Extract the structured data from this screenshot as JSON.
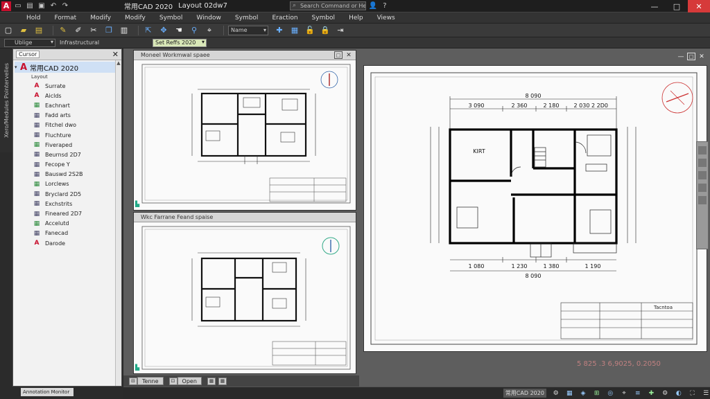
{
  "window": {
    "title": "常用CAD 2020",
    "document": "Layout 02dw7",
    "search_placeholder": "Search Command or Help",
    "min_label": "—",
    "max_label": "□",
    "close_label": "✕"
  },
  "menu": [
    "Hold",
    "Format",
    "Modify",
    "Modify",
    "Symbol",
    "Window",
    "Symbol",
    "Eraction",
    "Symbol",
    "Help",
    "Views"
  ],
  "toolbar": {
    "combo1": "Name",
    "combo2": "Name"
  },
  "layerbar": {
    "layer_combo": "Ublige",
    "layer_name": "Infrastructural",
    "layout_combo": "Set Reffs 2020"
  },
  "side_label": "Xero/Medules Pointervelles",
  "left_panel": {
    "title": "Cursor",
    "root": "常用CAD 2020",
    "sub": "Layout",
    "items": [
      {
        "label": "Surrate",
        "icon": "A"
      },
      {
        "label": "Aiclds",
        "icon": "A"
      },
      {
        "label": "Eachnart",
        "icon": "▦"
      },
      {
        "label": "Fadd arts",
        "icon": "▦"
      },
      {
        "label": "Fitchel dwo",
        "icon": "▦"
      },
      {
        "label": "Fluchture",
        "icon": "▦"
      },
      {
        "label": "Fiveraped",
        "icon": "▦"
      },
      {
        "label": "Beurnsd 2D7",
        "icon": "▦"
      },
      {
        "label": "Fecope Y",
        "icon": "▦"
      },
      {
        "label": "Bauswd 2S2B",
        "icon": "▦"
      },
      {
        "label": "Lorclews",
        "icon": "▦"
      },
      {
        "label": "Bryclard 2D5",
        "icon": "▦"
      },
      {
        "label": "Exchstrits",
        "icon": "▦"
      },
      {
        "label": "Fineared 2D7",
        "icon": "▦"
      },
      {
        "label": "Accelutd",
        "icon": "▦"
      },
      {
        "label": "Fanecad",
        "icon": "▦"
      },
      {
        "label": "Darode",
        "icon": "A"
      }
    ]
  },
  "status_left": "Annotation Monitor",
  "viewports": {
    "vp1_title": "Moneel Workmwal spaee",
    "vp2_title": "Wkc Farrane Feand spaise",
    "tabs": [
      "Tenne",
      "Open"
    ]
  },
  "plans": {
    "top_dims": [
      "3 090",
      "2 360",
      "2 180",
      "2 030",
      "2 2D0"
    ],
    "bottom_dims": [
      "1 080",
      "1 230",
      "1 380",
      "1 190"
    ],
    "total_dim": "8 090",
    "room_label": "KIRT"
  },
  "title_block_label": "Tacntoa",
  "coords": "5 825 .3 6,9025, 0.2050",
  "statusbar": {
    "app_label": "常用CAD 2020"
  }
}
